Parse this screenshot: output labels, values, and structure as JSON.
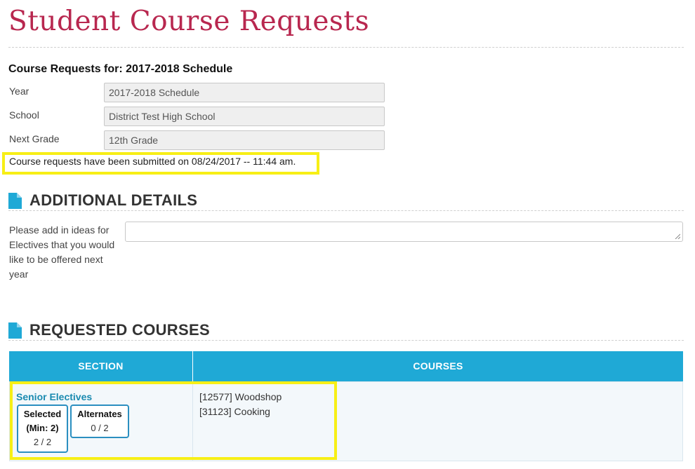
{
  "page": {
    "title": "Student Course Requests"
  },
  "requests": {
    "heading": "Course Requests for: 2017-2018 Schedule",
    "fields": [
      {
        "label": "Year",
        "value": "2017-2018 Schedule"
      },
      {
        "label": "School",
        "value": "District Test High School"
      },
      {
        "label": "Next Grade",
        "value": "12th Grade"
      }
    ],
    "submitted_text": "Course requests have been submitted on 08/24/2017 -- 11:44 am."
  },
  "additional_details": {
    "heading": "ADDITIONAL DETAILS",
    "label": "Please add in ideas for Electives that you would like to be offered next year",
    "value": ""
  },
  "requested_courses": {
    "heading": "REQUESTED COURSES",
    "columns": [
      "SECTION",
      "COURSES"
    ],
    "rows": [
      {
        "section_name": "Senior Electives",
        "selected_title_1": "Selected",
        "selected_title_2": "(Min: 2)",
        "selected_count": "2 / 2",
        "alternates_title": "Alternates",
        "alternates_count": "0 / 2",
        "courses": [
          "[12577] Woodshop",
          "[31123] Cooking"
        ]
      }
    ]
  },
  "colors": {
    "title": "#b8274f",
    "accent": "#1fa9d6",
    "highlight": "#f7ef16",
    "link": "#1a8ab0"
  },
  "icons": {
    "section_heading": "document-icon"
  }
}
